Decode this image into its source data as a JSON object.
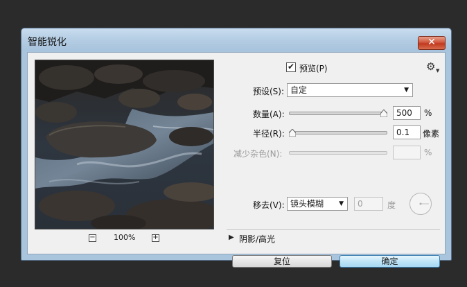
{
  "window": {
    "title": "智能锐化",
    "close_label": "✕"
  },
  "preview": {
    "zoom_value": "100%",
    "zoom_out_label": "−",
    "zoom_in_label": "+"
  },
  "options": {
    "preview_checkbox_label": "预览(P)",
    "preview_checked": true,
    "check_mark": "✔"
  },
  "preset": {
    "label": "预设(S):",
    "value": "自定"
  },
  "amount": {
    "label": "数量(A):",
    "value": "500",
    "unit": "%",
    "slider_fraction": 1.0
  },
  "radius": {
    "label": "半径(R):",
    "value": "0.1",
    "unit": "像素",
    "slider_fraction": 0.0
  },
  "noise": {
    "label": "减少杂色(N):",
    "value": "",
    "unit": "%"
  },
  "remove": {
    "label": "移去(V):",
    "value": "镜头模糊",
    "angle_value": "0",
    "angle_unit": "度"
  },
  "shadows_highlights": {
    "label": "阴影/高光"
  },
  "buttons": {
    "reset": "复位",
    "ok": "确定"
  },
  "colors": {
    "title_bar": "#b4cde4",
    "close_button": "#c0391f",
    "ok_button": "#bfe4f7",
    "dialog_bg": "#f0f0f0"
  }
}
